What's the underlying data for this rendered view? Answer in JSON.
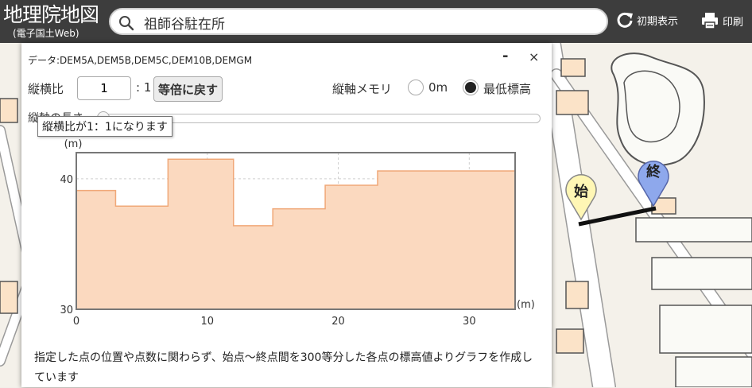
{
  "header": {
    "logo_main": "地理院地図",
    "logo_sub": "(電子国土Web)",
    "search_value": "祖師谷駐在所",
    "initial_view_label": "初期表示",
    "print_label": "印刷"
  },
  "map": {
    "start_marker": "始",
    "end_marker": "終"
  },
  "panel": {
    "data_sources": "データ:DEM5A,DEM5B,DEM5C,DEM10B,DEMGM",
    "minimize_label": "-",
    "close_label": "×",
    "aspect_label": "縦横比",
    "aspect_value": "1",
    "aspect_colon": ": 1",
    "reset_button": "等倍に戻す",
    "yaxis_scale_label": "縦軸メモリ",
    "option_zero": "0m",
    "option_min": "最低標高",
    "selected_option": "最低標高",
    "length_label": "縦軸の長さ",
    "tooltip": "縦横比が1：1になります",
    "note": "指定した点の位置や点数に関わらず、始点～終点間を300等分した各点の標高値よりグラフを作成しています"
  },
  "chart_data": {
    "type": "area",
    "ylabel": "(m)",
    "xlabel": "(m)",
    "xlim": [
      0,
      33.5
    ],
    "ylim": [
      30,
      42
    ],
    "xticks": [
      "0",
      "10",
      "20",
      "30"
    ],
    "yticks": [
      "30",
      "40"
    ],
    "grid": true,
    "x": [
      0,
      3,
      3,
      7,
      7,
      12,
      12,
      15,
      15,
      19,
      19,
      23,
      23,
      33.5
    ],
    "y": [
      39.1,
      39.1,
      37.9,
      37.9,
      41.5,
      41.5,
      36.4,
      36.4,
      37.7,
      37.7,
      39.5,
      39.5,
      40.6,
      40.6
    ],
    "colors": {
      "fill": "#fbd9bf",
      "stroke": "#f0a878"
    }
  }
}
